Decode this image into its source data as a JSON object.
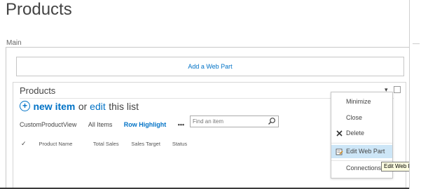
{
  "page": {
    "title": "Products"
  },
  "zone": {
    "label": "Main",
    "add_web_part": "Add a Web Part"
  },
  "webpart": {
    "title": "Products",
    "new_item": "new item",
    "or": " or ",
    "edit": "edit",
    "this_list": " this list",
    "views": [
      "CustomProductView",
      "All Items",
      "Row Highlight"
    ],
    "more": "•••",
    "search_placeholder": "Find an item",
    "check_mark": "✓",
    "columns": [
      "Product Name",
      "Total Sales",
      "Sales Target",
      "Status"
    ]
  },
  "menu": {
    "items": [
      "Minimize",
      "Close",
      "Delete",
      "Edit Web Part",
      "Connections"
    ],
    "tooltip": "Edit Web Part"
  },
  "colors": {
    "accent": "#0072c6",
    "hover": "#cde6f7",
    "tooltip_bg": "#ffffe1"
  }
}
